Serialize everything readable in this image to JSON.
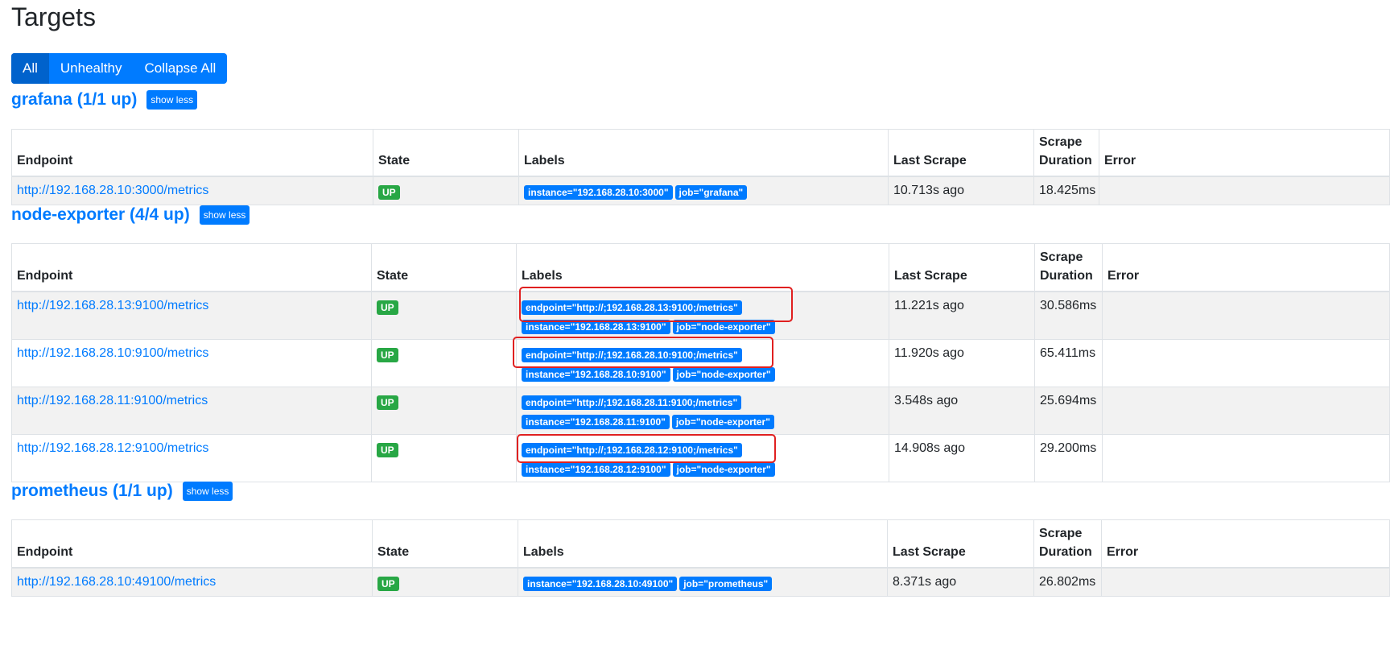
{
  "page": {
    "title": "Targets"
  },
  "filters": {
    "all": "All",
    "unhealthy": "Unhealthy",
    "collapse_all": "Collapse All"
  },
  "columns": {
    "endpoint": "Endpoint",
    "state": "State",
    "labels": "Labels",
    "last_scrape": "Last Scrape",
    "scrape_duration": "Scrape Duration",
    "error": "Error"
  },
  "highlight_color": "#e02020",
  "groups": [
    {
      "title": "grafana (1/1 up)",
      "toggle": "show less",
      "rows": [
        {
          "endpoint": "http://192.168.28.10:3000/metrics",
          "state": "UP",
          "labels": [
            "instance=\"192.168.28.10:3000\"",
            "job=\"grafana\""
          ],
          "last_scrape": "10.713s ago",
          "scrape_duration": "18.425ms",
          "error": ""
        }
      ]
    },
    {
      "title": "node-exporter (4/4 up)",
      "toggle": "show less",
      "rows": [
        {
          "endpoint": "http://192.168.28.13:9100/metrics",
          "state": "UP",
          "labels": [
            "endpoint=\"http://;192.168.28.13:9100;/metrics\"",
            "instance=\"192.168.28.13:9100\"",
            "job=\"node-exporter\""
          ],
          "last_scrape": "11.221s ago",
          "scrape_duration": "30.586ms",
          "error": ""
        },
        {
          "endpoint": "http://192.168.28.10:9100/metrics",
          "state": "UP",
          "labels": [
            "endpoint=\"http://;192.168.28.10:9100;/metrics\"",
            "instance=\"192.168.28.10:9100\"",
            "job=\"node-exporter\""
          ],
          "last_scrape": "11.920s ago",
          "scrape_duration": "65.411ms",
          "error": ""
        },
        {
          "endpoint": "http://192.168.28.11:9100/metrics",
          "state": "UP",
          "labels": [
            "endpoint=\"http://;192.168.28.11:9100;/metrics\"",
            "instance=\"192.168.28.11:9100\"",
            "job=\"node-exporter\""
          ],
          "last_scrape": "3.548s ago",
          "scrape_duration": "25.694ms",
          "error": ""
        },
        {
          "endpoint": "http://192.168.28.12:9100/metrics",
          "state": "UP",
          "labels": [
            "endpoint=\"http://;192.168.28.12:9100;/metrics\"",
            "instance=\"192.168.28.12:9100\"",
            "job=\"node-exporter\""
          ],
          "last_scrape": "14.908s ago",
          "scrape_duration": "29.200ms",
          "error": ""
        }
      ]
    },
    {
      "title": "prometheus (1/1 up)",
      "toggle": "show less",
      "rows": [
        {
          "endpoint": "http://192.168.28.10:49100/metrics",
          "state": "UP",
          "labels": [
            "instance=\"192.168.28.10:49100\"",
            "job=\"prometheus\""
          ],
          "last_scrape": "8.371s ago",
          "scrape_duration": "26.802ms",
          "error": ""
        }
      ]
    }
  ]
}
